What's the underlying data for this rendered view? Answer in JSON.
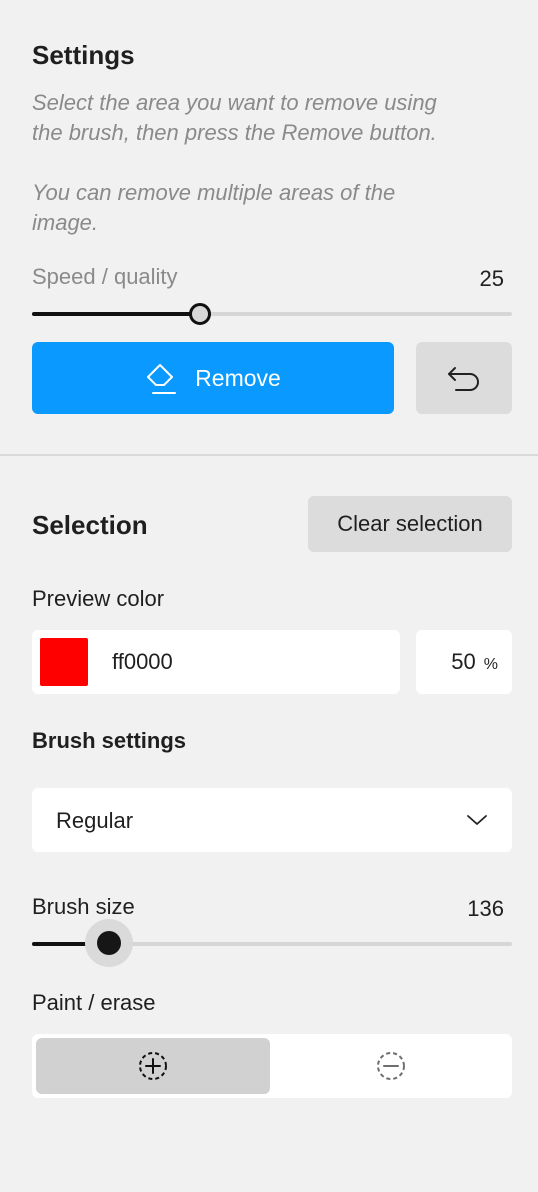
{
  "settings": {
    "title": "Settings",
    "hint_line1": "Select the area you want to remove using",
    "hint_line2": "the brush, then press the Remove button.",
    "hint_line3": "You can remove multiple areas of the",
    "hint_line4": "image.",
    "speed_label": "Speed / quality",
    "speed_value": "25",
    "speed_fraction": 0.35,
    "remove_label": "Remove"
  },
  "selection": {
    "title": "Selection",
    "clear_label": "Clear selection",
    "preview_color_label": "Preview color",
    "color_hex": "ff0000",
    "swatch_color": "#ff0000",
    "opacity_value": "50",
    "opacity_unit": "%",
    "brush_settings_label": "Brush settings",
    "brush_type": "Regular",
    "brush_size_label": "Brush size",
    "brush_size_value": "136",
    "brush_size_fraction": 0.16,
    "paint_erase_label": "Paint / erase",
    "active_mode": "paint"
  },
  "colors": {
    "accent": "#0a99ff",
    "background": "#f1f1f1"
  },
  "icons": {
    "remove": "eraser-icon",
    "undo": "undo-icon",
    "dropdown": "chevron-down-icon",
    "paint": "add-circle-dashed-icon",
    "erase": "remove-circle-dashed-icon"
  }
}
